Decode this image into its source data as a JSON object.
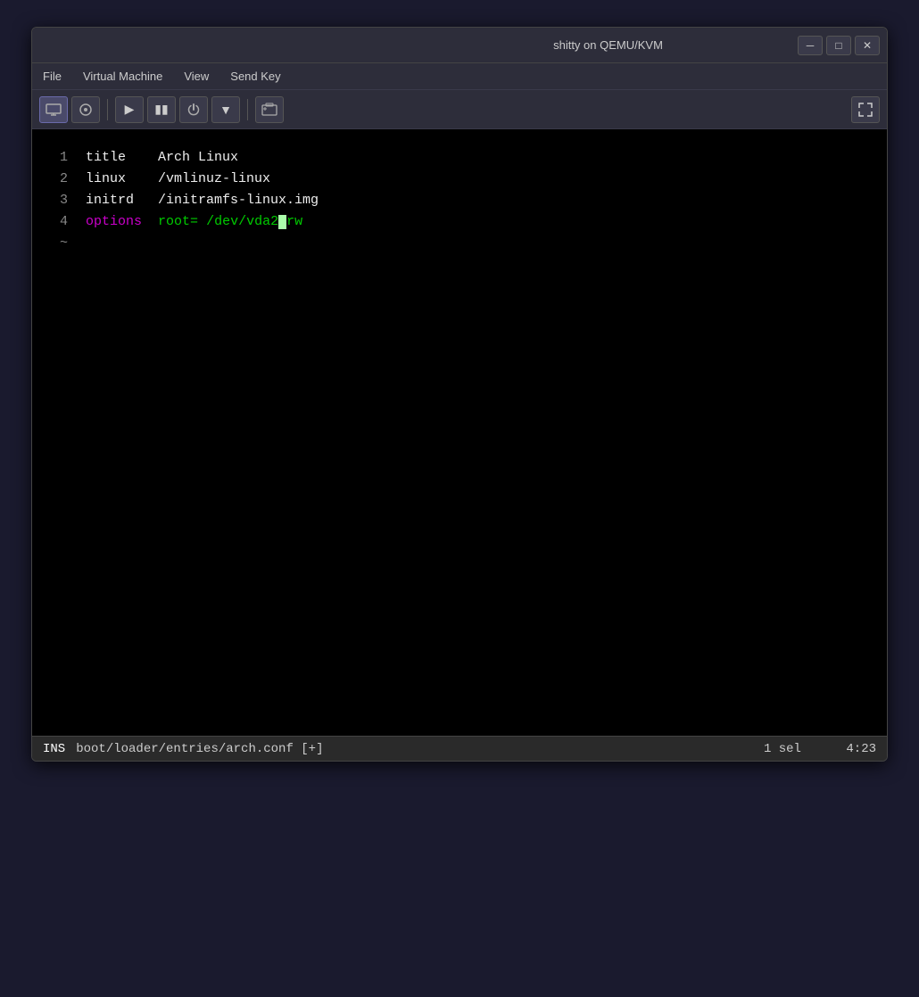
{
  "window": {
    "title": "shitty on QEMU/KVM",
    "controls": {
      "minimize": "─",
      "maximize": "□",
      "close": "✕"
    }
  },
  "menubar": {
    "items": [
      "File",
      "Virtual Machine",
      "View",
      "Send Key"
    ]
  },
  "toolbar": {
    "buttons": [
      {
        "name": "display-icon",
        "symbol": "▭"
      },
      {
        "name": "power-indicator",
        "symbol": "⊙"
      },
      {
        "name": "play-button",
        "symbol": "▶"
      },
      {
        "name": "pause-button",
        "symbol": "⏸"
      },
      {
        "name": "power-button",
        "symbol": "⏻"
      },
      {
        "name": "dropdown-button",
        "symbol": "▾"
      }
    ],
    "right_button": {
      "name": "screenshot-button",
      "symbol": "⎙"
    },
    "expand_button": {
      "name": "expand-button",
      "symbol": "⤢"
    }
  },
  "editor": {
    "lines": [
      {
        "num": "1",
        "parts": [
          {
            "text": "title",
            "color": "white"
          },
          {
            "text": "   Arch Linux",
            "color": "white"
          }
        ]
      },
      {
        "num": "2",
        "parts": [
          {
            "text": "linux",
            "color": "white"
          },
          {
            "text": "   /vmlinuz-linux",
            "color": "white"
          }
        ]
      },
      {
        "num": "3",
        "parts": [
          {
            "text": "initrd",
            "color": "white"
          },
          {
            "text": "  /initramfs-linux.img",
            "color": "white"
          }
        ]
      },
      {
        "num": "4",
        "parts": [
          {
            "text": "options",
            "color": "magenta"
          },
          {
            "text": " root=",
            "color": "green"
          },
          {
            "text": "/dev/vda2",
            "color": "green"
          },
          {
            "text": "CURSOR",
            "color": "cursor"
          },
          {
            "text": "rw",
            "color": "green"
          }
        ]
      }
    ],
    "tilde": "~"
  },
  "statusbar": {
    "mode": "INS",
    "file": "boot/loader/entries/arch.conf [+]",
    "position": "1 sel",
    "time": "4:23"
  }
}
